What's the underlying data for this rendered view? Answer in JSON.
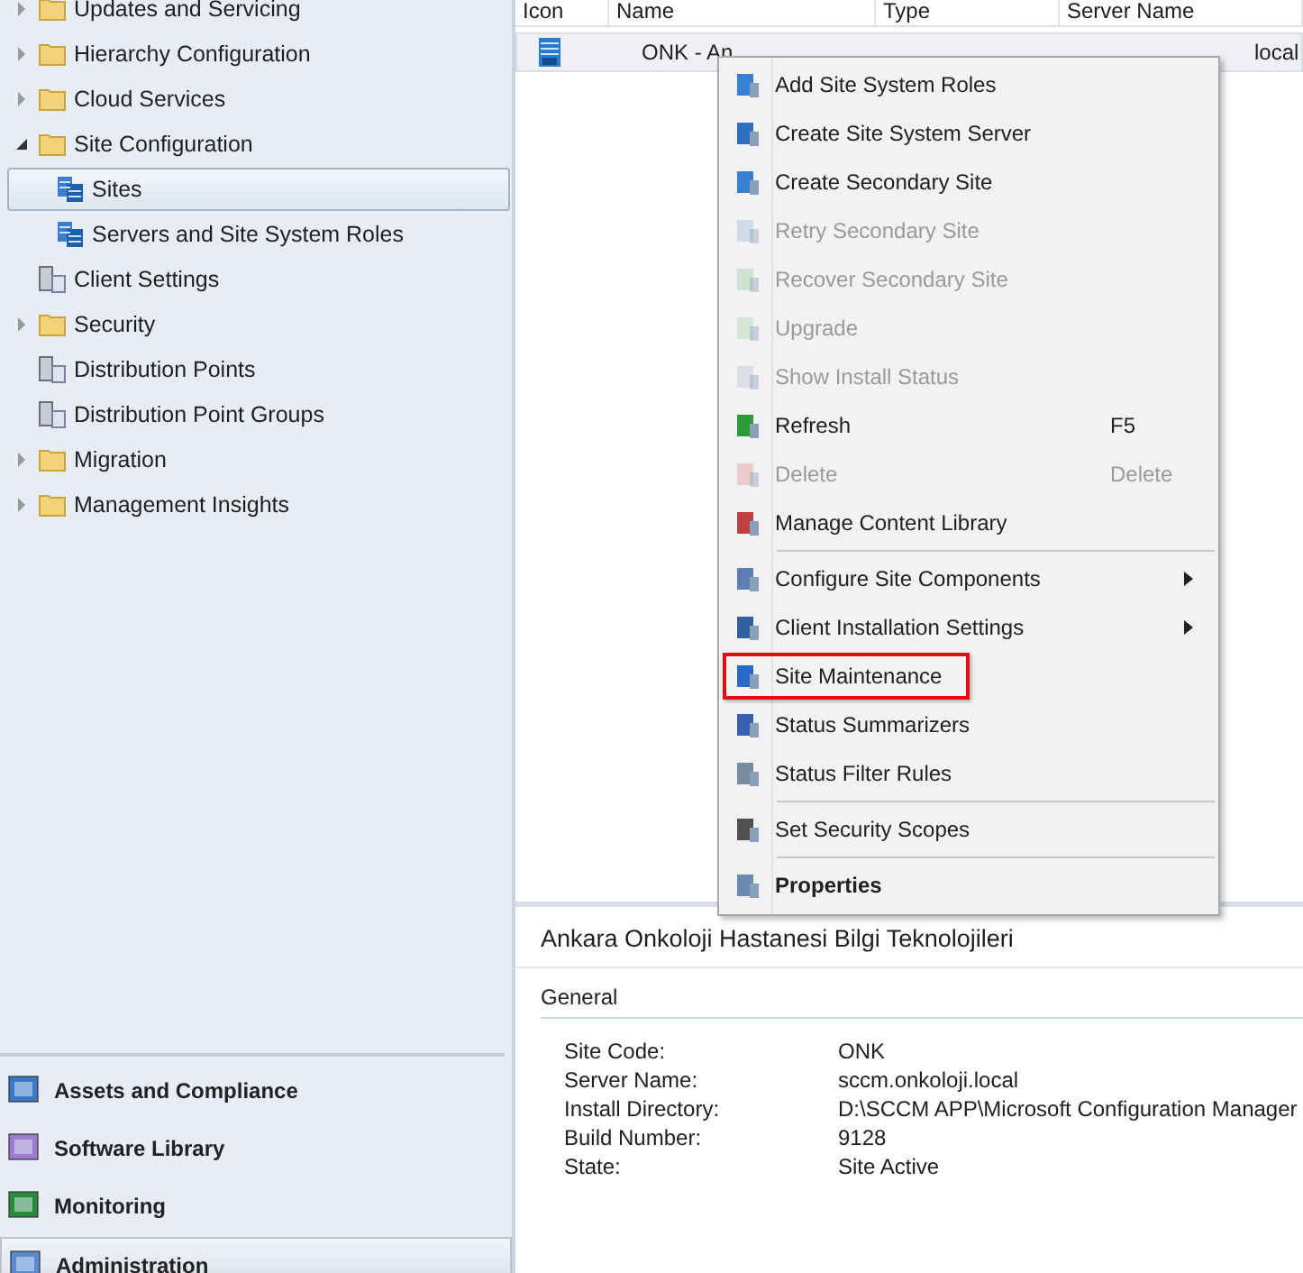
{
  "navigation_tree": [
    {
      "label": "Updates and Servicing",
      "expanded": false,
      "selected": false
    },
    {
      "label": "Hierarchy Configuration",
      "expanded": false,
      "selected": false
    },
    {
      "label": "Cloud Services",
      "expanded": false,
      "selected": false
    },
    {
      "label": "Site Configuration",
      "expanded": true,
      "selected": false,
      "children": [
        {
          "label": "Sites",
          "selected": true
        },
        {
          "label": "Servers and Site System Roles",
          "selected": false
        }
      ]
    },
    {
      "label": "Client Settings",
      "selected": false
    },
    {
      "label": "Security",
      "expanded": false,
      "selected": false
    },
    {
      "label": "Distribution Points",
      "selected": false
    },
    {
      "label": "Distribution Point Groups",
      "selected": false
    },
    {
      "label": "Migration",
      "expanded": false,
      "selected": false
    },
    {
      "label": "Management Insights",
      "expanded": false,
      "selected": false
    }
  ],
  "workspaces": [
    {
      "label": "Assets and Compliance",
      "selected": false
    },
    {
      "label": "Software Library",
      "selected": false
    },
    {
      "label": "Monitoring",
      "selected": false
    },
    {
      "label": "Administration",
      "selected": true
    }
  ],
  "table": {
    "columns": [
      "Icon",
      "Name",
      "Type",
      "Server Name"
    ],
    "rows": [
      {
        "name": "ONK - An",
        "server_name": "local",
        "selected": true
      }
    ]
  },
  "context_menu": {
    "groups": [
      [
        {
          "label": "Add Site System Roles",
          "disabled": false,
          "submenu": false,
          "bold": false,
          "outlined": false
        },
        {
          "label": "Create Site System Server",
          "disabled": false,
          "submenu": false,
          "bold": false,
          "outlined": false
        },
        {
          "label": "Create Secondary Site",
          "disabled": false,
          "submenu": false,
          "bold": false,
          "outlined": false
        },
        {
          "label": "Retry Secondary Site",
          "disabled": true,
          "submenu": false,
          "bold": false,
          "outlined": false
        },
        {
          "label": "Recover Secondary Site",
          "disabled": true,
          "submenu": false,
          "bold": false,
          "outlined": false
        },
        {
          "label": "Upgrade",
          "disabled": true,
          "submenu": false,
          "bold": false,
          "outlined": false
        },
        {
          "label": "Show Install Status",
          "disabled": true,
          "submenu": false,
          "bold": false,
          "outlined": false
        },
        {
          "label": "Refresh",
          "shortcut": "F5",
          "disabled": false,
          "submenu": false,
          "bold": false,
          "outlined": false
        },
        {
          "label": "Delete",
          "shortcut": "Delete",
          "disabled": true,
          "submenu": false,
          "bold": false,
          "outlined": false
        },
        {
          "label": "Manage Content Library",
          "disabled": false,
          "submenu": false,
          "bold": false,
          "outlined": false
        }
      ],
      [
        {
          "label": "Configure Site Components",
          "disabled": false,
          "submenu": true,
          "bold": false,
          "outlined": false
        },
        {
          "label": "Client Installation Settings",
          "disabled": false,
          "submenu": true,
          "bold": false,
          "outlined": false
        },
        {
          "label": "Site Maintenance",
          "disabled": false,
          "submenu": false,
          "bold": false,
          "outlined": true
        },
        {
          "label": "Status Summarizers",
          "disabled": false,
          "submenu": false,
          "bold": false,
          "outlined": false
        },
        {
          "label": "Status Filter Rules",
          "disabled": false,
          "submenu": false,
          "bold": false,
          "outlined": false
        }
      ],
      [
        {
          "label": "Set Security Scopes",
          "disabled": false,
          "submenu": false,
          "bold": false,
          "outlined": false
        }
      ],
      [
        {
          "label": "Properties",
          "disabled": false,
          "submenu": false,
          "bold": true,
          "outlined": false
        }
      ]
    ]
  },
  "details": {
    "title": "Ankara Onkoloji Hastanesi Bilgi Teknolojileri",
    "section": "General",
    "properties": [
      {
        "label": "Site Code:",
        "value": "ONK"
      },
      {
        "label": "Server Name:",
        "value": "sccm.onkoloji.local"
      },
      {
        "label": "Install Directory:",
        "value": "D:\\SCCM APP\\Microsoft Configuration Manager"
      },
      {
        "label": "Build Number:",
        "value": "9128"
      },
      {
        "label": "State:",
        "value": "Site Active"
      }
    ]
  }
}
